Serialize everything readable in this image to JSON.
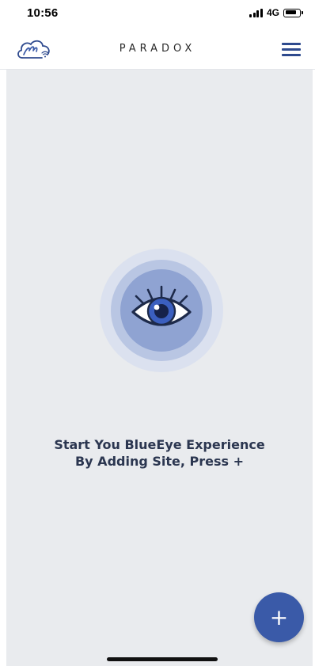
{
  "status_bar": {
    "time": "10:56",
    "network": "4G"
  },
  "header": {
    "brand": "PARADOX",
    "logo_icon": "cloud-swirl-icon",
    "menu_icon": "hamburger-menu-icon"
  },
  "main": {
    "illustration_icon": "eye-icon",
    "message_line1": "Start You BlueEye Experience",
    "message_line2": "By Adding Site, Press +"
  },
  "fab": {
    "label": "+",
    "icon": "plus-icon"
  },
  "colors": {
    "accent": "#3a5aa8",
    "header_icon": "#2e4a8e",
    "background": "#e9ebee",
    "text": "#2b3650"
  }
}
